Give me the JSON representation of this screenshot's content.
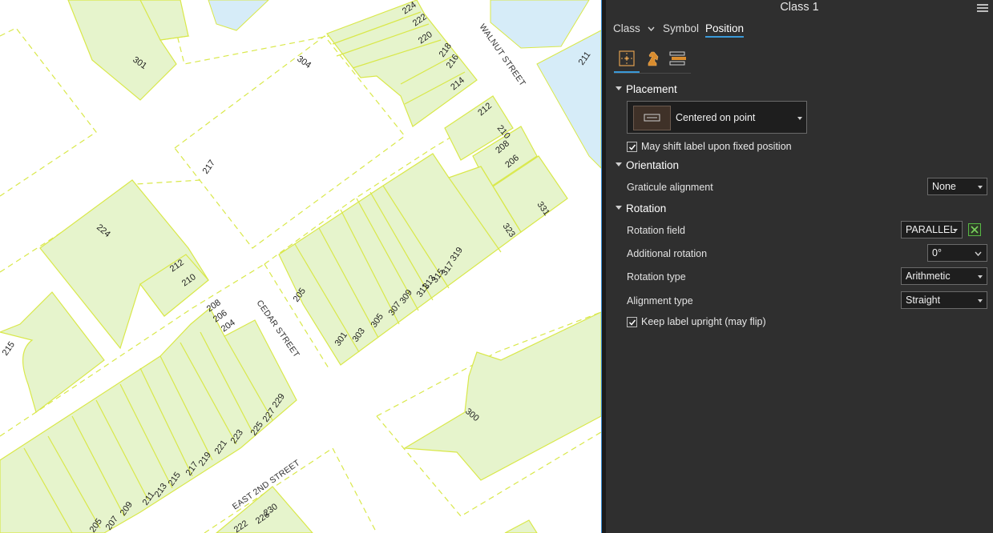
{
  "map": {
    "parcel_labels": [
      "224",
      "222",
      "220",
      "218",
      "216",
      "214",
      "212",
      "210",
      "208",
      "206",
      "331",
      "323",
      "319",
      "317",
      "315",
      "313",
      "311",
      "309",
      "307",
      "305",
      "303",
      "301",
      "205",
      "301",
      "304",
      "217",
      "224",
      "212",
      "210",
      "208",
      "206",
      "204",
      "215",
      "229",
      "227",
      "225",
      "223",
      "221",
      "219",
      "217",
      "215",
      "213",
      "211",
      "209",
      "207",
      "205",
      "211",
      "300",
      "230",
      "226",
      "222"
    ],
    "street_labels": {
      "walnut": "WALNUT STREET",
      "cedar": "CEDAR STREET",
      "east_2nd": "EAST 2ND STREET"
    },
    "colors": {
      "parcel_fill": "#e6f4cc",
      "parcel_outline": "#d9e84a",
      "water": "#d6ecf8",
      "background": "#ffffff"
    }
  },
  "panel": {
    "title": "Class 1",
    "tabs": {
      "class": "Class",
      "symbol": "Symbol",
      "position": "Position"
    },
    "subtab_icons": [
      "position-placement-icon",
      "chess-knight-icon",
      "fitting-strategy-icon"
    ],
    "placement": {
      "header": "Placement",
      "value": "Centered on point",
      "may_shift_label": "May shift label upon fixed position",
      "may_shift_checked": true
    },
    "orientation": {
      "header": "Orientation",
      "graticule_label": "Graticule alignment",
      "graticule_value": "None"
    },
    "rotation": {
      "header": "Rotation",
      "field_label": "Rotation field",
      "field_value": "PARALLEL",
      "additional_label": "Additional rotation",
      "additional_value": "0°",
      "type_label": "Rotation type",
      "type_value": "Arithmetic",
      "alignment_label": "Alignment type",
      "alignment_value": "Straight",
      "keep_upright_label": "Keep label upright (may flip)",
      "keep_upright_checked": true
    },
    "colors": {
      "accent": "#3a9ad9",
      "panel_bg": "#2f2f2f",
      "expression_green": "#58b845"
    }
  }
}
